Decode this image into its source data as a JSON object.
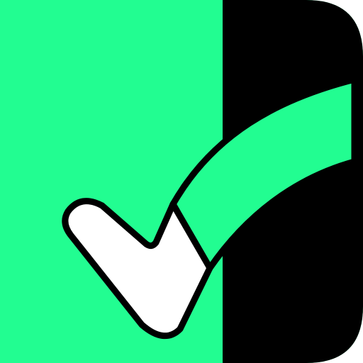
{
  "icon": {
    "name": "checkmark-app-icon",
    "colors": {
      "green": "#22FD91",
      "black": "#000000",
      "white": "#FFFFFF"
    }
  }
}
